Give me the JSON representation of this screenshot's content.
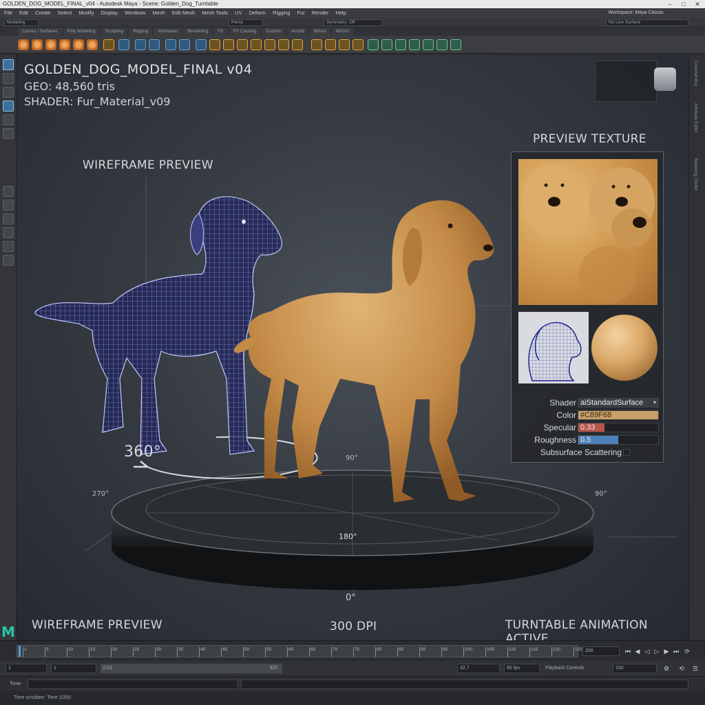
{
  "titlebar": {
    "title": "GOLDEN_DOG_MODEL_FINAL_v04 - Autodesk Maya - Scene: Golden_Dog_Turntable"
  },
  "menubar": {
    "items": [
      "File",
      "Edit",
      "Create",
      "Select",
      "Modify",
      "Display",
      "Windows",
      "Mesh",
      "Edit Mesh",
      "Mesh Tools",
      "UV",
      "Deform",
      "Rigging",
      "Fur",
      "Render",
      "Help"
    ],
    "right_label": "Workspace: Maya Classic"
  },
  "statusline": {
    "mode": "Modeling",
    "snap": "No Live Surface",
    "panel_field": "Persp",
    "search": "Symmetry: Off"
  },
  "shelf": {
    "tabs": [
      "Curves / Surfaces",
      "Poly Modeling",
      "Sculpting",
      "Rigging",
      "Animation",
      "Rendering",
      "FX",
      "FX Caching",
      "Custom",
      "Arnold",
      "Bifrost",
      "MASH"
    ]
  },
  "viewport": {
    "title": "GOLDEN_DOG_MODEL_FINAL v04",
    "geo": "GEO: 48,560 tris",
    "shader": "SHADER: Fur_Material_v09",
    "wire_label_top": "WIREFRAME PREVIEW",
    "wire_label_bottom": "WIREFRAME PREVIEW",
    "rotation_label": "360°",
    "dpi": "300 DPI",
    "turntable": "TURNTABLE ANIMATION ACTIVE",
    "deg_0": "0°",
    "deg_90": "90°",
    "deg_180": "180°",
    "deg_270": "270°"
  },
  "panel": {
    "title": "PREVIEW TEXTURE",
    "shader_label": "Shader",
    "shader_value": "aiStandardSurface",
    "color_label": "Color",
    "color_value": "#C89F68",
    "color_hex": "#c89f68",
    "specular_label": "Specular",
    "specular_value": "0.33",
    "specular_level": 0.33,
    "roughness_label": "Roughness",
    "roughness_value": "0.5",
    "roughness_level": 0.5,
    "sss_label": "Subsurface Scattering"
  },
  "timeline": {
    "ticks": [
      "1",
      "5",
      "10",
      "15",
      "20",
      "25",
      "30",
      "35",
      "40",
      "45",
      "50",
      "55",
      "60",
      "65",
      "70",
      "75",
      "80",
      "85",
      "90",
      "95",
      "100",
      "105",
      "110",
      "115",
      "120",
      "125"
    ],
    "current_frame": "200"
  },
  "range": {
    "start": "1",
    "inner_start": "1",
    "slider_start": "0.01",
    "slider_end": "320",
    "end": "32.7",
    "fps": "60 fps",
    "playback": "Playback Controls",
    "speed": "100"
  },
  "cmdline": {
    "label": "Time"
  },
  "helpline": {
    "text": "Time scrubber: Time 1/200"
  }
}
